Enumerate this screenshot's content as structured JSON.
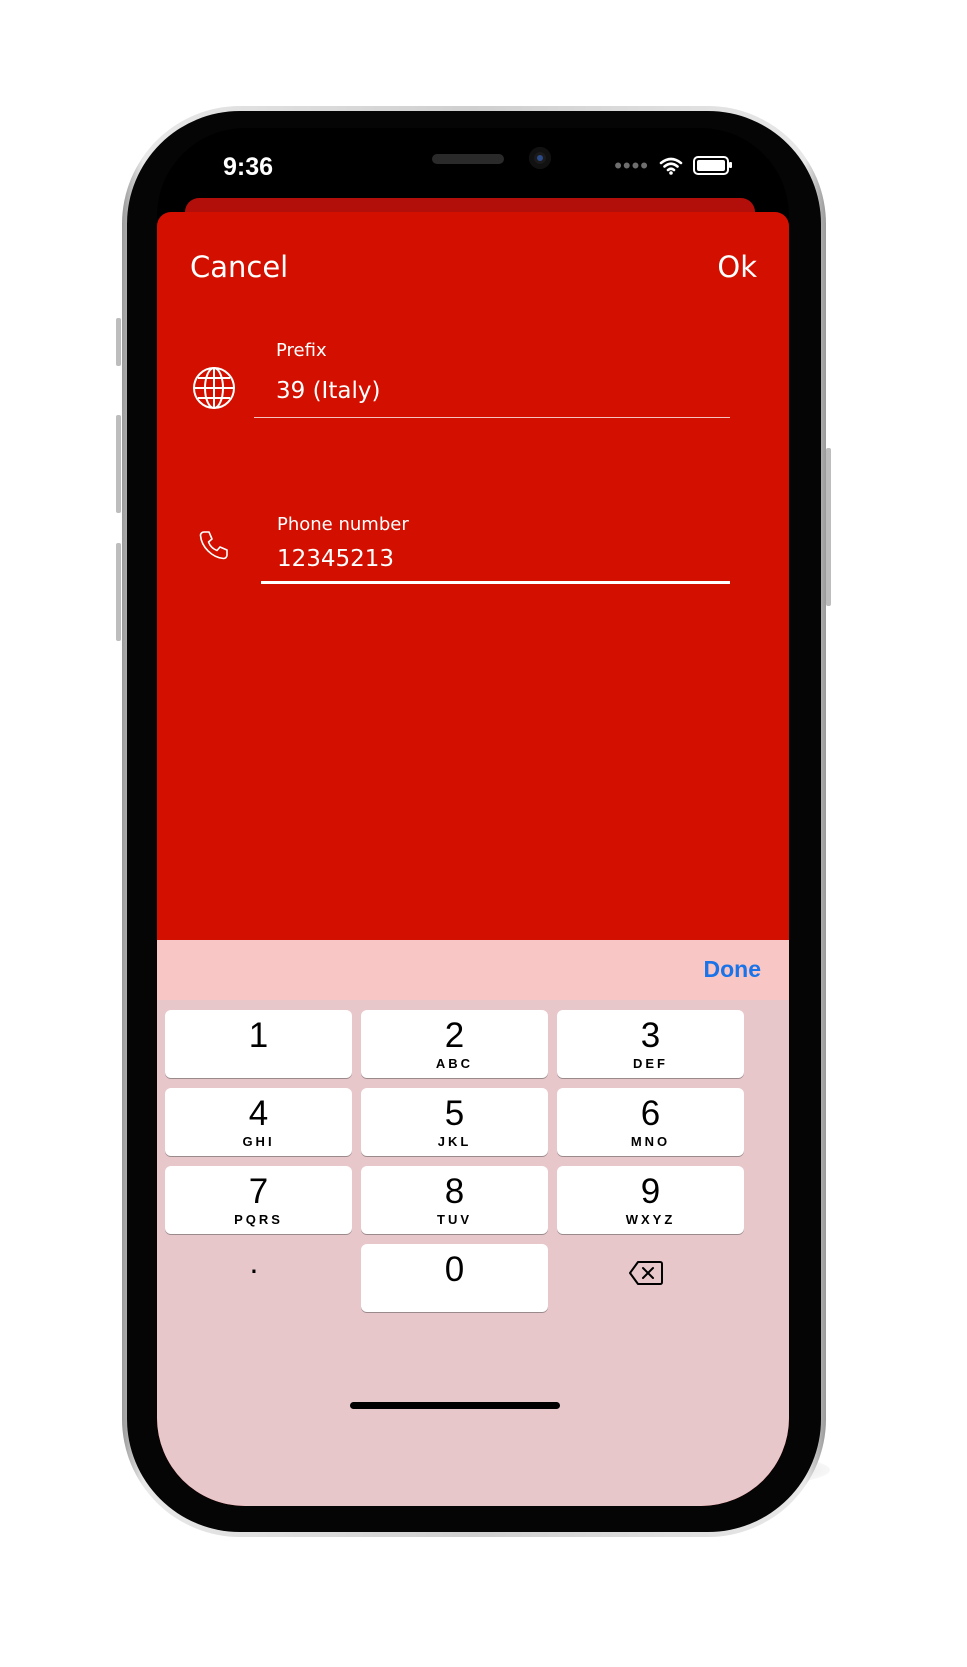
{
  "status_bar": {
    "time": "9:36",
    "signal_icon": "signal-dots-icon",
    "wifi_icon": "wifi-icon",
    "battery_icon": "battery-icon"
  },
  "nav": {
    "cancel_label": "Cancel",
    "ok_label": "Ok"
  },
  "form": {
    "prefix": {
      "icon": "globe-icon",
      "label": "Prefix",
      "value": "39 (Italy)"
    },
    "phone": {
      "icon": "phone-icon",
      "label": "Phone number",
      "value": "12345213"
    }
  },
  "keyboard": {
    "done_label": "Done",
    "keys": [
      {
        "digit": "1",
        "letters": ""
      },
      {
        "digit": "2",
        "letters": "ABC"
      },
      {
        "digit": "3",
        "letters": "DEF"
      },
      {
        "digit": "4",
        "letters": "GHI"
      },
      {
        "digit": "5",
        "letters": "JKL"
      },
      {
        "digit": "6",
        "letters": "MNO"
      },
      {
        "digit": "7",
        "letters": "PQRS"
      },
      {
        "digit": "8",
        "letters": "TUV"
      },
      {
        "digit": "9",
        "letters": "WXYZ"
      },
      {
        "digit": "0",
        "letters": ""
      }
    ],
    "dot_label": ".",
    "backspace_icon": "backspace-icon"
  },
  "colors": {
    "sheet_background": "#d31000",
    "keyboard_toolbar": "#f8c6c4",
    "keyboard_background": "#e8c7cb",
    "done_accent": "#1a73e8"
  }
}
